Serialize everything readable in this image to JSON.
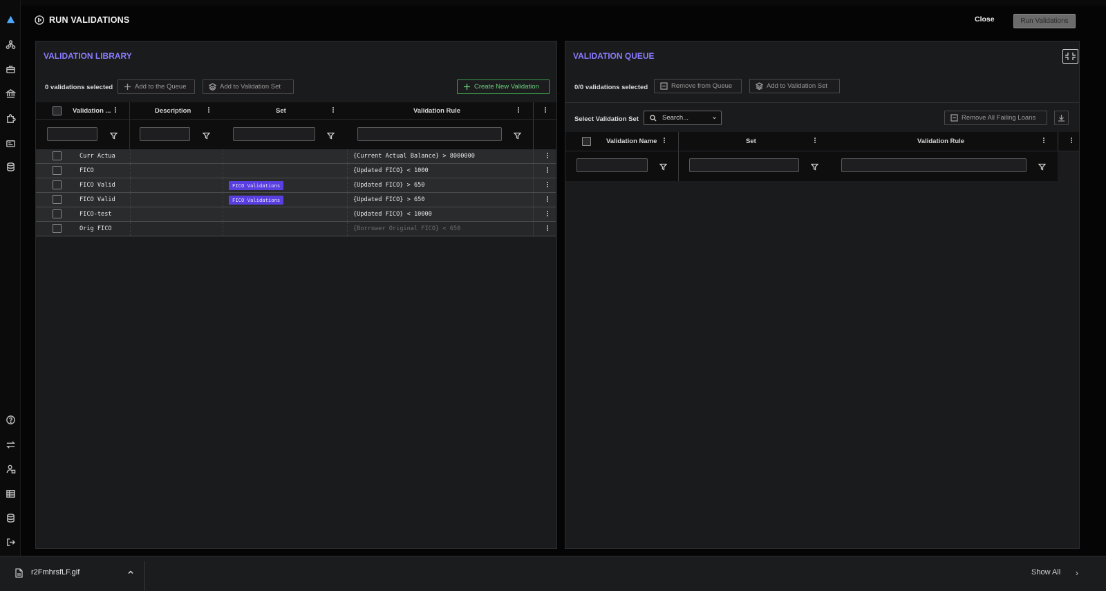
{
  "header": {
    "title": "RUN VALIDATIONS",
    "close_label": "Close",
    "run_label": "Run Validations"
  },
  "library": {
    "title": "VALIDATION LIBRARY",
    "selected_count": "0 validations selected",
    "add_queue_label": "Add to the Queue",
    "add_set_label": "Add to Validation Set",
    "create_label": "Create New Validation",
    "columns": [
      "Validation ...",
      "Description",
      "Set",
      "Validation Rule"
    ],
    "rows": [
      {
        "name": "Curr Actua",
        "description": "",
        "set": "",
        "rule": "{Current Actual Balance} > 8000000"
      },
      {
        "name": "FICO",
        "description": "",
        "set": "",
        "rule": "{Updated FICO} < 1000"
      },
      {
        "name": "FICO Valid",
        "description": "",
        "set": "FICO Validations",
        "rule": "{Updated FICO} > 650"
      },
      {
        "name": "FICO Valid",
        "description": "",
        "set": "FICO Validations",
        "rule": "{Updated FICO} > 650"
      },
      {
        "name": "FICO-test",
        "description": "",
        "set": "",
        "rule": "{Updated FICO} < 10000"
      },
      {
        "name": "Orig FICO",
        "description": "",
        "set": "",
        "rule": "{Borrower Original FICO} < 650"
      }
    ]
  },
  "queue": {
    "title": "VALIDATION QUEUE",
    "selected_count": "0/0 validations selected",
    "remove_label": "Remove from Queue",
    "add_set_label": "Add to Validation Set",
    "select_set_label": "Select Validation Set",
    "search_placeholder": "Search...",
    "remove_failing_label": "Remove All Failing Loans",
    "columns": [
      "Validation Name",
      "Set",
      "Validation Rule"
    ]
  },
  "download_bar": {
    "file_name": "r2FmhrsfLF.gif",
    "show_all_label": "Show All"
  },
  "colors": {
    "accent": "#8a7cff",
    "badge": "#5a3fe0",
    "create_button": "#6ad17a"
  }
}
